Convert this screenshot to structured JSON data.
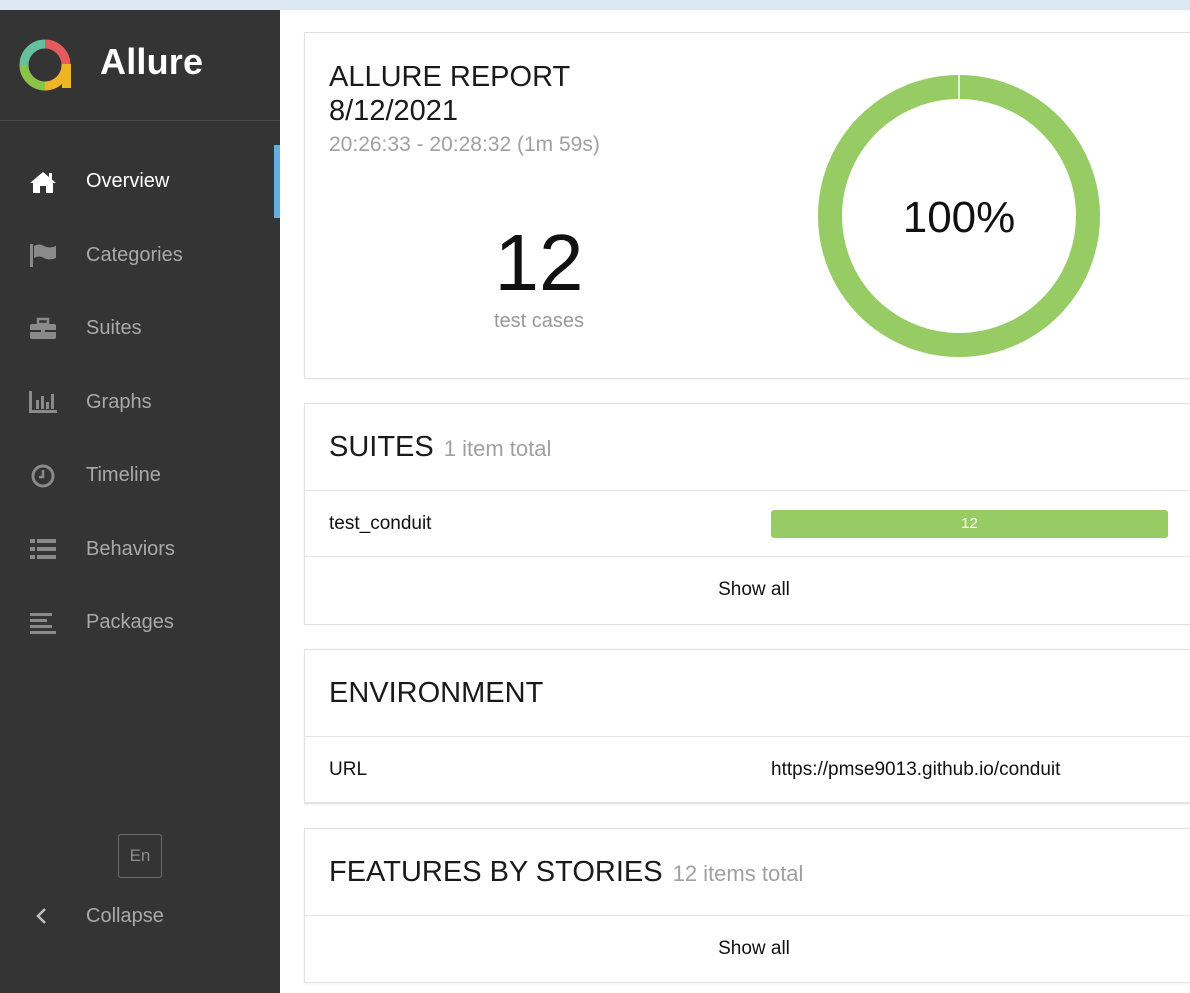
{
  "brand": {
    "title": "Allure",
    "logo_icon": "allure-logo-icon"
  },
  "sidebar": {
    "items": [
      {
        "label": "Overview",
        "icon": "home-icon",
        "active": true
      },
      {
        "label": "Categories",
        "icon": "flag-icon",
        "active": false
      },
      {
        "label": "Suites",
        "icon": "briefcase-icon",
        "active": false
      },
      {
        "label": "Graphs",
        "icon": "bar-chart-icon",
        "active": false
      },
      {
        "label": "Timeline",
        "icon": "clock-icon",
        "active": false
      },
      {
        "label": "Behaviors",
        "icon": "list-icon",
        "active": false
      },
      {
        "label": "Packages",
        "icon": "align-left-icon",
        "active": false
      }
    ],
    "language": "En",
    "collapse_label": "Collapse"
  },
  "summary": {
    "title": "ALLURE REPORT",
    "date": "8/12/2021",
    "time_range": "20:26:33 - 20:28:32 (1m 59s)",
    "test_count": "12",
    "test_count_label": "test cases",
    "pass_rate_text": "100%",
    "pass_rate": 1.0
  },
  "suites": {
    "title": "SUITES",
    "subtitle": "1 item total",
    "rows": [
      {
        "name": "test_conduit",
        "value": "12"
      }
    ],
    "show_all": "Show all"
  },
  "environment": {
    "title": "ENVIRONMENT",
    "rows": [
      {
        "key": "URL",
        "value": "https://pmse9013.github.io/conduit"
      }
    ]
  },
  "features": {
    "title": "FEATURES BY STORIES",
    "subtitle": "12 items total",
    "show_all": "Show all"
  },
  "colors": {
    "sidebar_bg": "#343434",
    "accent": "#66aee0",
    "passed": "#97cc64"
  }
}
